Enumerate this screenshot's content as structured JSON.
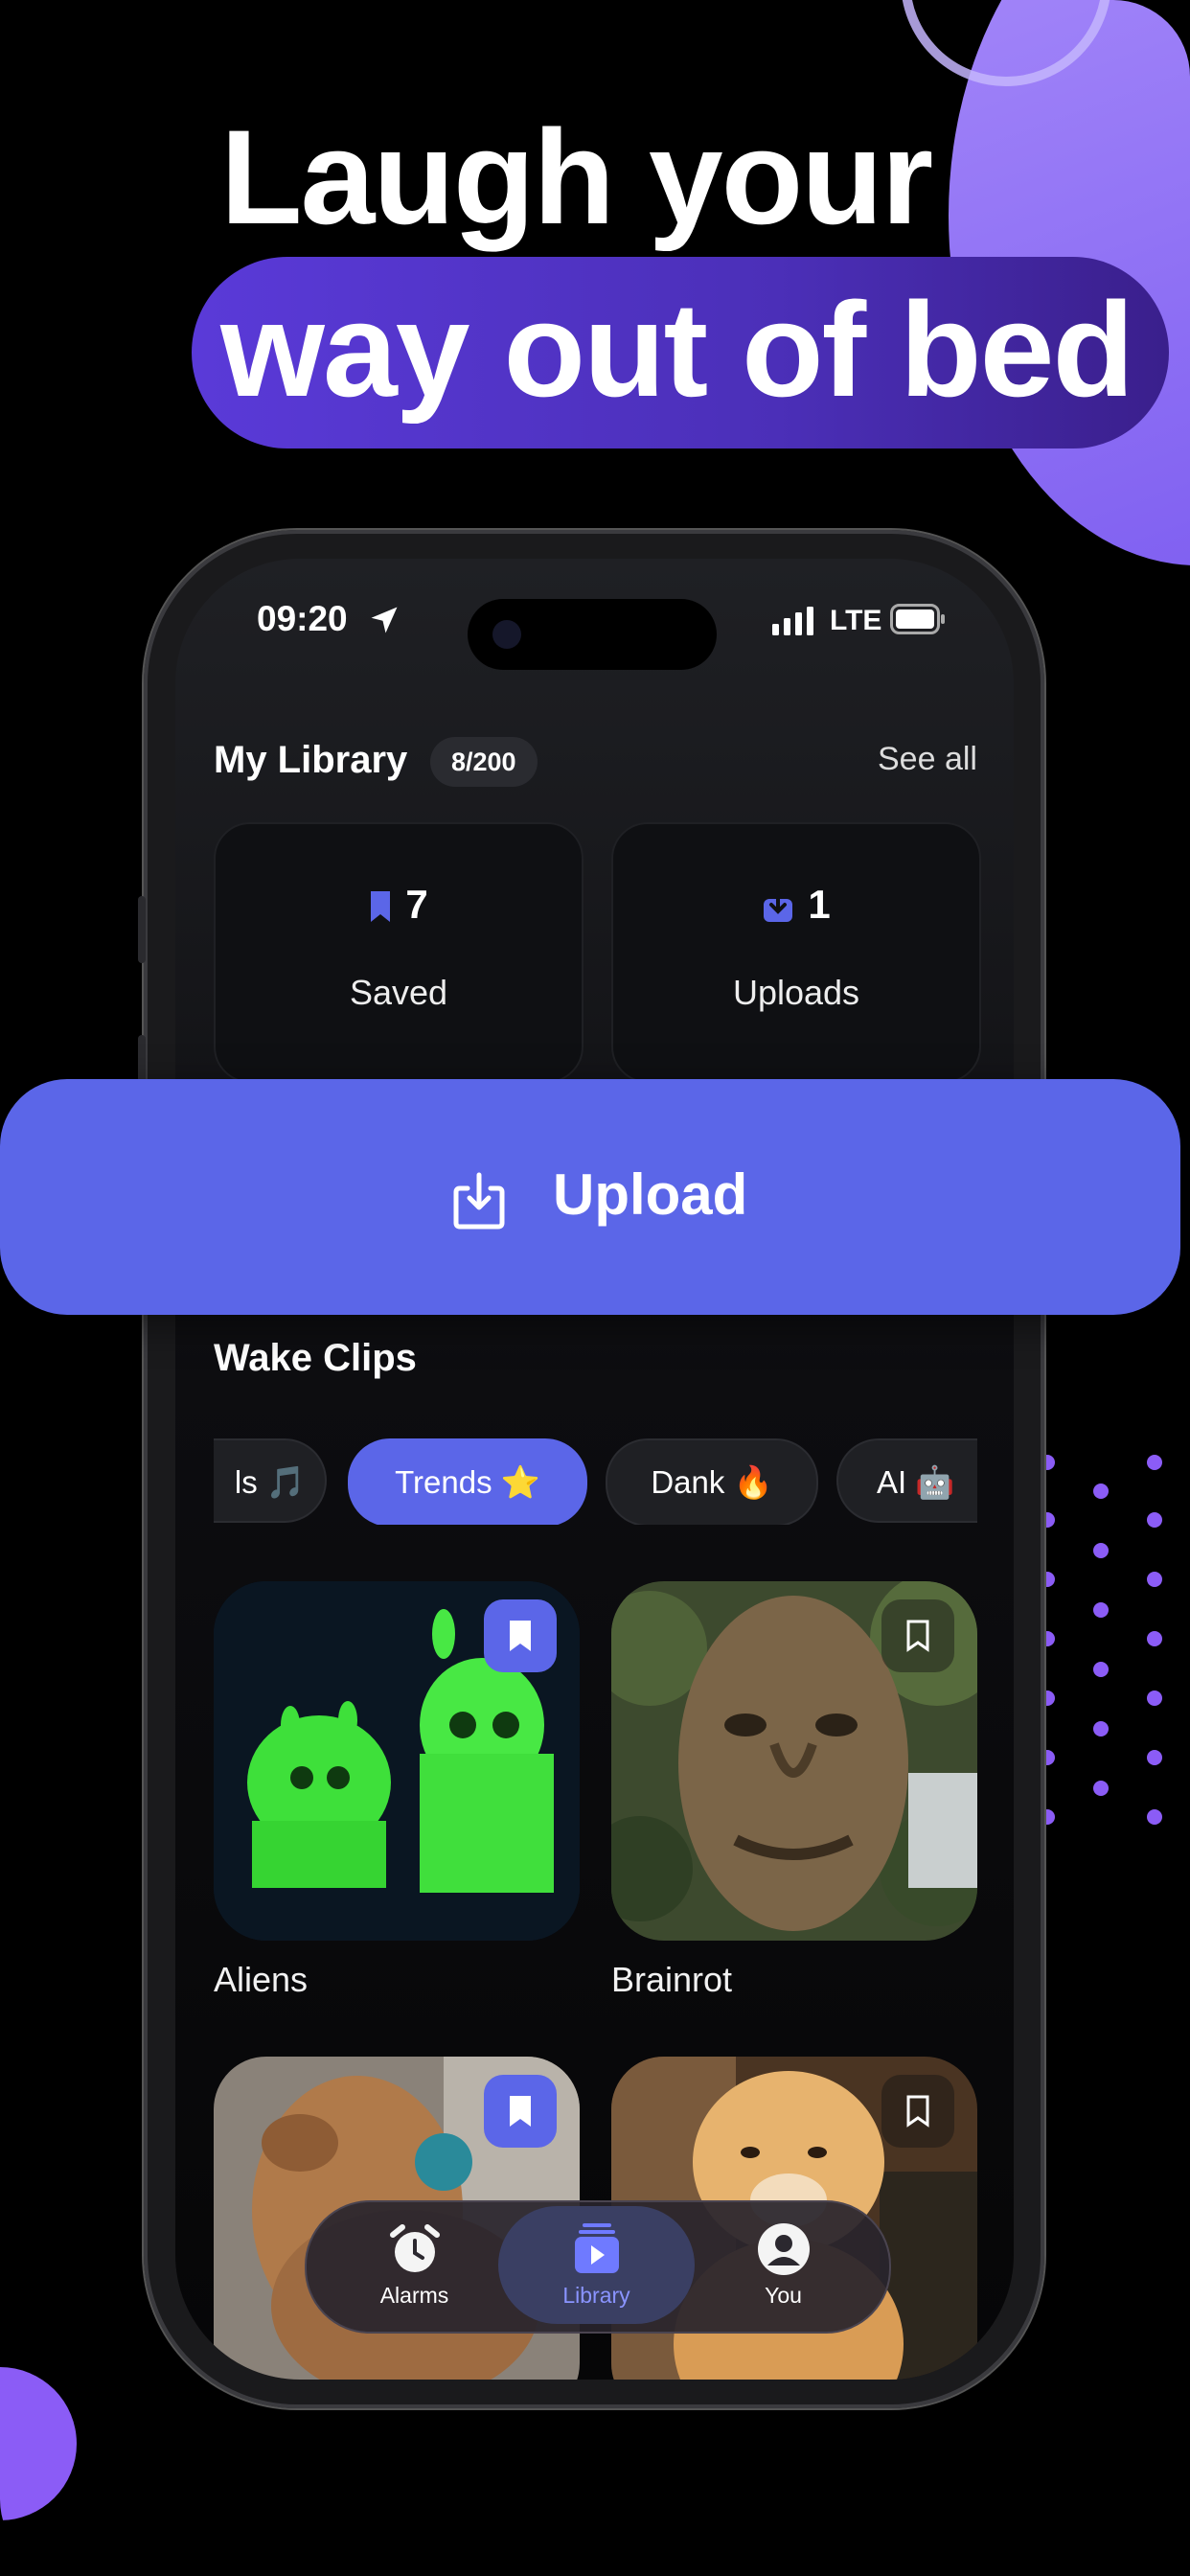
{
  "headline": {
    "line1": "Laugh your",
    "line2": "way out of bed"
  },
  "status_bar": {
    "time": "09:20",
    "network": "LTE"
  },
  "library": {
    "title": "My Library",
    "count_badge": "8/200",
    "see_all": "See all",
    "stats": [
      {
        "icon": "bookmark-icon",
        "value": "7",
        "label": "Saved"
      },
      {
        "icon": "download-tray-icon",
        "value": "1",
        "label": "Uploads"
      }
    ]
  },
  "upload_button": {
    "label": "Upload",
    "icon": "upload-tray-icon"
  },
  "wake_clips": {
    "title": "Wake Clips",
    "chips": [
      {
        "label": "ls 🎵",
        "active": false
      },
      {
        "label": "Trends ⭐",
        "active": true
      },
      {
        "label": "Dank 🔥",
        "active": false
      },
      {
        "label": "AI 🤖",
        "active": false
      }
    ],
    "clips": [
      {
        "label": "Aliens",
        "saved": true
      },
      {
        "label": "Brainrot",
        "saved": false
      },
      {
        "label": "",
        "saved": true
      },
      {
        "label": "",
        "saved": false
      }
    ]
  },
  "tab_bar": {
    "tabs": [
      {
        "label": "Alarms",
        "icon": "alarm-clock-icon",
        "active": false
      },
      {
        "label": "Library",
        "icon": "library-play-icon",
        "active": true
      },
      {
        "label": "You",
        "icon": "profile-icon",
        "active": false
      }
    ]
  },
  "colors": {
    "accent": "#5b66e8",
    "purple_blob": "#8b5cf6",
    "background": "#000000"
  }
}
